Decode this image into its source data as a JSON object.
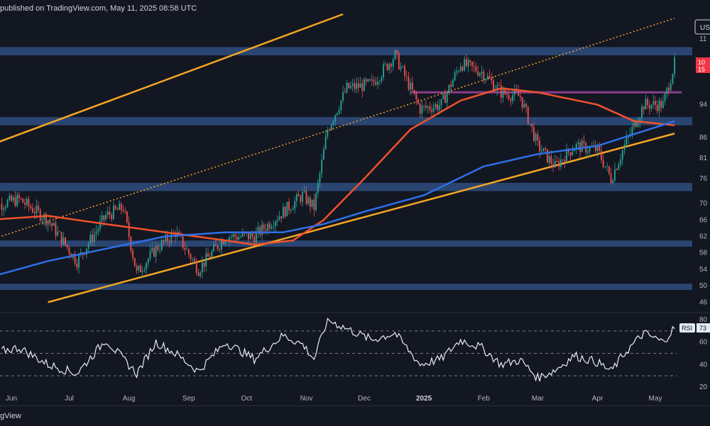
{
  "header": {
    "text": "published on TradingView.com, May 11, 2025 08:58 UTC"
  },
  "footer": {
    "brand": "gView"
  },
  "price_axis": {
    "currency_badge": "US",
    "ticks": [
      "11",
      "94",
      "86",
      "81",
      "76",
      "70",
      "66",
      "62",
      "58",
      "54",
      "50",
      "46"
    ],
    "current_price_label": "10",
    "countdown_label": "15"
  },
  "rsi_axis": {
    "ticks": [
      "80",
      "60",
      "40",
      "20"
    ],
    "indicator_label": "RSI",
    "indicator_value": "73"
  },
  "colors": {
    "background": "#131722",
    "support_zone": "#2d4a7a",
    "candle_up": "#26a69a",
    "candle_down": "#ef5350",
    "ma_red": "#f0522d",
    "ma_blue": "#2f6fe8",
    "channel": "#f5a623",
    "rsi_line": "#e8ecf5",
    "price_badge": "#f23645",
    "resistance_line": "#8a3e8a"
  },
  "chart_data": {
    "type": "candlestick",
    "y_unit": "thousand USD",
    "x_tick_labels": [
      "Jun",
      "Jul",
      "Aug",
      "Sep",
      "Oct",
      "Nov",
      "Dec",
      "2025",
      "Feb",
      "Mar",
      "Apr",
      "May"
    ],
    "x_tick_dates": [
      "2024-06-01",
      "2024-07-01",
      "2024-08-01",
      "2024-09-01",
      "2024-10-01",
      "2024-11-01",
      "2024-12-01",
      "2025-01-01",
      "2025-02-01",
      "2025-03-01",
      "2025-04-01",
      "2025-05-01"
    ],
    "ylim": [
      44,
      116
    ],
    "price_points": [
      {
        "date": "2024-05-20",
        "close": 69
      },
      {
        "date": "2024-06-05",
        "close": 71
      },
      {
        "date": "2024-06-20",
        "close": 66
      },
      {
        "date": "2024-07-05",
        "close": 56
      },
      {
        "date": "2024-07-20",
        "close": 67
      },
      {
        "date": "2024-07-29",
        "close": 69
      },
      {
        "date": "2024-08-05",
        "close": 53
      },
      {
        "date": "2024-08-15",
        "close": 59
      },
      {
        "date": "2024-08-25",
        "close": 63
      },
      {
        "date": "2024-09-06",
        "close": 54
      },
      {
        "date": "2024-09-20",
        "close": 62
      },
      {
        "date": "2024-10-05",
        "close": 62
      },
      {
        "date": "2024-10-20",
        "close": 68
      },
      {
        "date": "2024-10-30",
        "close": 72
      },
      {
        "date": "2024-11-05",
        "close": 69
      },
      {
        "date": "2024-11-12",
        "close": 88
      },
      {
        "date": "2024-11-22",
        "close": 98
      },
      {
        "date": "2024-12-05",
        "close": 99
      },
      {
        "date": "2024-12-17",
        "close": 106
      },
      {
        "date": "2024-12-30",
        "close": 93
      },
      {
        "date": "2025-01-10",
        "close": 94
      },
      {
        "date": "2025-01-20",
        "close": 104
      },
      {
        "date": "2025-01-31",
        "close": 102
      },
      {
        "date": "2025-02-10",
        "close": 97
      },
      {
        "date": "2025-02-20",
        "close": 96
      },
      {
        "date": "2025-03-01",
        "close": 84
      },
      {
        "date": "2025-03-10",
        "close": 79
      },
      {
        "date": "2025-03-20",
        "close": 84
      },
      {
        "date": "2025-04-01",
        "close": 83
      },
      {
        "date": "2025-04-08",
        "close": 76
      },
      {
        "date": "2025-04-15",
        "close": 84
      },
      {
        "date": "2025-04-25",
        "close": 94
      },
      {
        "date": "2025-05-05",
        "close": 94
      },
      {
        "date": "2025-05-11",
        "close": 104
      }
    ],
    "moving_averages": [
      {
        "color": "red",
        "points": [
          {
            "date": "2024-05-20",
            "close": 66
          },
          {
            "date": "2024-06-20",
            "close": 67
          },
          {
            "date": "2024-07-20",
            "close": 65
          },
          {
            "date": "2024-08-20",
            "close": 63
          },
          {
            "date": "2024-09-20",
            "close": 61
          },
          {
            "date": "2024-10-05",
            "close": 60
          },
          {
            "date": "2024-10-25",
            "close": 61
          },
          {
            "date": "2024-11-10",
            "close": 66
          },
          {
            "date": "2024-12-01",
            "close": 76
          },
          {
            "date": "2024-12-25",
            "close": 88
          },
          {
            "date": "2025-01-20",
            "close": 95
          },
          {
            "date": "2025-02-10",
            "close": 98
          },
          {
            "date": "2025-03-01",
            "close": 97
          },
          {
            "date": "2025-04-01",
            "close": 94
          },
          {
            "date": "2025-04-20",
            "close": 90
          },
          {
            "date": "2025-05-11",
            "close": 89
          }
        ]
      },
      {
        "color": "blue",
        "points": [
          {
            "date": "2024-05-20",
            "close": 52
          },
          {
            "date": "2024-06-20",
            "close": 56
          },
          {
            "date": "2024-07-20",
            "close": 59
          },
          {
            "date": "2024-08-20",
            "close": 62
          },
          {
            "date": "2024-09-20",
            "close": 63
          },
          {
            "date": "2024-10-20",
            "close": 63
          },
          {
            "date": "2024-11-10",
            "close": 65
          },
          {
            "date": "2024-12-01",
            "close": 68
          },
          {
            "date": "2025-01-01",
            "close": 72
          },
          {
            "date": "2025-02-01",
            "close": 79
          },
          {
            "date": "2025-03-01",
            "close": 82
          },
          {
            "date": "2025-04-01",
            "close": 84
          },
          {
            "date": "2025-05-11",
            "close": 90
          }
        ]
      }
    ],
    "support_resistance_zones": [
      [
        106,
        108
      ],
      [
        89,
        91
      ],
      [
        73,
        75
      ],
      [
        59.5,
        61
      ],
      [
        49,
        50.5
      ]
    ],
    "resistance_line": {
      "value": 97,
      "from": "2024-12-25",
      "to": "2025-05-11"
    },
    "channel_lines": [
      {
        "style": "solid",
        "from": {
          "date": "2024-05-20",
          "close": 84
        },
        "to": {
          "date": "2024-11-20",
          "close": 116
        }
      },
      {
        "style": "solid",
        "from": {
          "date": "2024-06-20",
          "close": 46
        },
        "to": {
          "date": "2025-05-11",
          "close": 87
        }
      },
      {
        "style": "dotted",
        "from": {
          "date": "2024-05-20",
          "close": 61
        },
        "to": {
          "date": "2025-05-11",
          "close": 115
        }
      }
    ],
    "rsi": {
      "ylim": [
        20,
        80
      ],
      "bands": [
        70,
        50,
        30
      ],
      "points": [
        {
          "date": "2024-05-20",
          "value": 50
        },
        {
          "date": "2024-06-05",
          "value": 55
        },
        {
          "date": "2024-06-20",
          "value": 40
        },
        {
          "date": "2024-07-05",
          "value": 32
        },
        {
          "date": "2024-07-20",
          "value": 62
        },
        {
          "date": "2024-08-05",
          "value": 32
        },
        {
          "date": "2024-08-15",
          "value": 60
        },
        {
          "date": "2024-08-25",
          "value": 50
        },
        {
          "date": "2024-09-06",
          "value": 34
        },
        {
          "date": "2024-09-20",
          "value": 60
        },
        {
          "date": "2024-10-05",
          "value": 45
        },
        {
          "date": "2024-10-20",
          "value": 66
        },
        {
          "date": "2024-10-30",
          "value": 58
        },
        {
          "date": "2024-11-05",
          "value": 45
        },
        {
          "date": "2024-11-12",
          "value": 80
        },
        {
          "date": "2024-11-22",
          "value": 72
        },
        {
          "date": "2024-12-05",
          "value": 62
        },
        {
          "date": "2024-12-17",
          "value": 68
        },
        {
          "date": "2024-12-30",
          "value": 40
        },
        {
          "date": "2025-01-10",
          "value": 45
        },
        {
          "date": "2025-01-20",
          "value": 62
        },
        {
          "date": "2025-01-31",
          "value": 55
        },
        {
          "date": "2025-02-10",
          "value": 40
        },
        {
          "date": "2025-02-20",
          "value": 44
        },
        {
          "date": "2025-03-01",
          "value": 28
        },
        {
          "date": "2025-03-10",
          "value": 35
        },
        {
          "date": "2025-03-20",
          "value": 48
        },
        {
          "date": "2025-04-01",
          "value": 42
        },
        {
          "date": "2025-04-08",
          "value": 34
        },
        {
          "date": "2025-04-15",
          "value": 50
        },
        {
          "date": "2025-04-25",
          "value": 68
        },
        {
          "date": "2025-05-05",
          "value": 60
        },
        {
          "date": "2025-05-11",
          "value": 73
        }
      ]
    }
  }
}
